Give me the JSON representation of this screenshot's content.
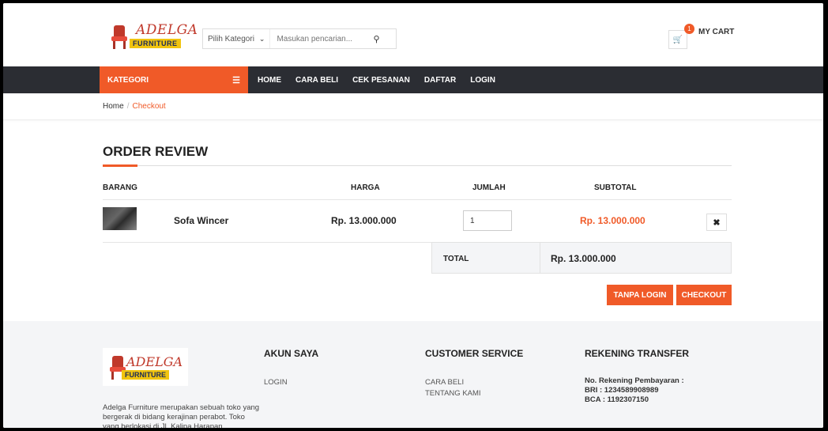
{
  "header": {
    "logo_text": "ADELGA",
    "logo_sub": "FURNITURE",
    "category_select": "Pilih Kategori",
    "search_placeholder": "Masukan pencarian...",
    "cart_count": "1",
    "cart_label": "MY CART"
  },
  "nav": {
    "kategori": "KATEGORI",
    "links": [
      "HOME",
      "CARA BELI",
      "CEK PESANAN",
      "DAFTAR",
      "LOGIN"
    ]
  },
  "breadcrumb": {
    "home": "Home",
    "sep": "/",
    "current": "Checkout"
  },
  "order": {
    "title": "ORDER REVIEW",
    "columns": [
      "BARANG",
      "HARGA",
      "JUMLAH",
      "SUBTOTAL"
    ],
    "items": [
      {
        "name": "Sofa Wincer",
        "price": "Rp. 13.000.000",
        "qty": "1",
        "subtotal": "Rp. 13.000.000"
      }
    ],
    "total_label": "TOTAL",
    "total_value": "Rp. 13.000.000",
    "btn_tanpa_login": "TANPA LOGIN",
    "btn_checkout": "CHECKOUT"
  },
  "footer": {
    "description": "Adelga Furniture merupakan sebuah toko yang bergerak di bidang kerajinan perabot. Toko yang berlokasi di Jl. Kalipa Harapan ...",
    "akun": {
      "title": "AKUN SAYA",
      "links": [
        "LOGIN"
      ]
    },
    "cs": {
      "title": "CUSTOMER SERVICE",
      "links": [
        "CARA BELI",
        "TENTANG KAMI"
      ]
    },
    "rekening": {
      "title": "REKENING TRANSFER",
      "line1": "No. Rekening Pembayaran :",
      "line2": "BRI : 1234589908989",
      "line3": "BCA : 1192307150"
    }
  },
  "colors": {
    "accent": "#f05a28",
    "nav_bg": "#2b2d33",
    "footer_bg": "#f4f5f7"
  }
}
